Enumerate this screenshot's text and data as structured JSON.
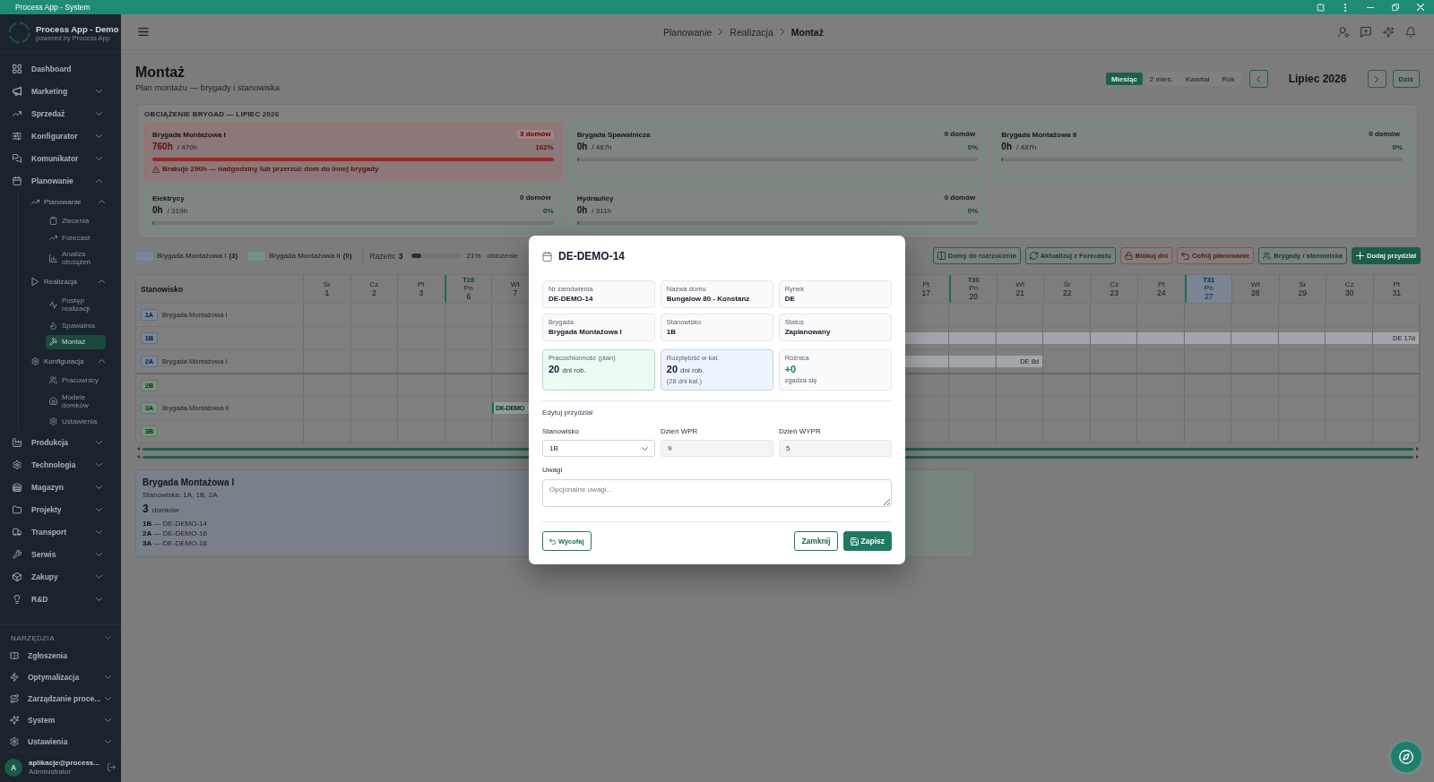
{
  "window": {
    "title": "Process App - System"
  },
  "sidebar": {
    "brand": {
      "name": "Process App - Demo",
      "tagline": "powered by Process App"
    },
    "items": [
      {
        "label": "Dashboard",
        "selected": false
      },
      {
        "label": "Marketing",
        "selected": false,
        "expanded": false
      },
      {
        "label": "Sprzedaż",
        "selected": false,
        "expanded": false
      },
      {
        "label": "Konfigurator",
        "selected": false,
        "expanded": false
      },
      {
        "label": "Komunikator",
        "selected": false,
        "expanded": false
      },
      {
        "label": "Planowanie",
        "selected": false,
        "expanded": true,
        "children": [
          {
            "label": "Planowanie",
            "selected": false,
            "expanded": true,
            "children": [
              {
                "label": "Zlecenia",
                "selected": false
              },
              {
                "label": "Forecast",
                "selected": false
              },
              {
                "label": "Analiza obciążeń",
                "selected": false
              }
            ]
          },
          {
            "label": "Realizacja",
            "selected": false,
            "expanded": true,
            "children": [
              {
                "label": "Postęp realizacji",
                "selected": false
              },
              {
                "label": "Spawalnia",
                "selected": false
              },
              {
                "label": "Montaż",
                "selected": true
              }
            ]
          },
          {
            "label": "Konfiguracja",
            "selected": false,
            "expanded": true,
            "children": [
              {
                "label": "Pracownicy",
                "selected": false
              },
              {
                "label": "Modele domków",
                "selected": false
              },
              {
                "label": "Ustawienia",
                "selected": false
              }
            ]
          }
        ]
      },
      {
        "label": "Produkcja",
        "selected": false,
        "expanded": false
      },
      {
        "label": "Technologia",
        "selected": false,
        "expanded": false
      },
      {
        "label": "Magazyn",
        "selected": false,
        "expanded": false
      },
      {
        "label": "Projekty",
        "selected": false,
        "expanded": false
      },
      {
        "label": "Transport",
        "selected": false,
        "expanded": false
      },
      {
        "label": "Serwis",
        "selected": false,
        "expanded": false
      },
      {
        "label": "Zakupy",
        "selected": false,
        "expanded": false
      },
      {
        "label": "R&D",
        "selected": false,
        "expanded": false
      }
    ],
    "tools": {
      "title": "NARZĘDZIA",
      "items": [
        {
          "label": "Zgłoszenia",
          "selected": false
        },
        {
          "label": "Optymalizacja",
          "selected": false,
          "expanded": false
        },
        {
          "label": "Zarządzanie proce...",
          "selected": false,
          "expanded": false
        },
        {
          "label": "System",
          "selected": false,
          "expanded": false
        },
        {
          "label": "Ustawienia",
          "selected": false,
          "expanded": false
        }
      ]
    },
    "user": {
      "initial": "A",
      "name": "aplikacje@process...",
      "role": "Administrator"
    }
  },
  "header": {
    "breadcrumb": [
      {
        "label": "Planowanie",
        "current": false
      },
      {
        "label": "Realizacja",
        "current": false
      },
      {
        "label": "Montaż",
        "current": true
      }
    ]
  },
  "page": {
    "title": "Montaż",
    "subtitle": "Plan montażu — brygady i stanowiska",
    "views": [
      {
        "label": "Miesiąc",
        "selected": true
      },
      {
        "label": "2 mies.",
        "selected": false
      },
      {
        "label": "Kwartał",
        "selected": false
      },
      {
        "label": "Rok",
        "selected": false
      }
    ],
    "period": "Lipiec 2026",
    "today_button": "Dziś"
  },
  "workload": {
    "title": "OBCIĄŻENIE BRYGAD — LIPIEC 2026",
    "brigades": [
      {
        "name": "Brygada Montażowa I",
        "houses": "3 domów",
        "hours": "760h",
        "capacity": "/ 470h",
        "percent": "162%",
        "level": 1,
        "overloaded": true,
        "warning": "Brakuje 290h — nadgodziny lub przerzuć dom do innej brygady"
      },
      {
        "name": "Brygada Spawalnicza",
        "houses": "0 domów",
        "hours": "0h",
        "capacity": "/ 487h",
        "percent": "0%",
        "level": 0,
        "overloaded": false
      },
      {
        "name": "Brygada Montażowa II",
        "houses": "0 domów",
        "hours": "0h",
        "capacity": "/ 487h",
        "percent": "0%",
        "level": 0,
        "overloaded": false
      },
      {
        "name": "Elektrycy",
        "houses": "0 domów",
        "hours": "0h",
        "capacity": "/ 319h",
        "percent": "0%",
        "level": 0,
        "overloaded": false
      },
      {
        "name": "Hydraulicy",
        "houses": "0 domów",
        "hours": "0h",
        "capacity": "/ 311h",
        "percent": "0%",
        "level": 0,
        "overloaded": false
      }
    ]
  },
  "legend": {
    "items": [
      {
        "label": "Brygada Montażowa I",
        "count": "(3)",
        "color": "#7a8799"
      },
      {
        "label": "Brygada Montażowa II",
        "count": "(0)",
        "color": "#76917f"
      }
    ],
    "total_label": "Razem:",
    "total": "3",
    "level": 0.21,
    "percent": "21%",
    "percent_label": "obłożenie"
  },
  "toolbar": {
    "buttons": [
      {
        "label": "Domy do rozrzucenia",
        "kind": "outline"
      },
      {
        "label": "Aktualizuj z Forecastu",
        "kind": "outline"
      },
      {
        "label": "Blokuj dni",
        "kind": "danger"
      },
      {
        "label": "Cofnij planowanie",
        "kind": "danger"
      },
      {
        "label": "Brygady / stanowiska",
        "kind": "outline"
      },
      {
        "label": "Dodaj przydział",
        "kind": "primary"
      }
    ]
  },
  "schedule": {
    "station_header": "Stanowisko",
    "days_left": [
      {
        "weekday": "Śr",
        "day": "1",
        "today": false
      },
      {
        "weekday": "Cz",
        "day": "2",
        "today": false
      },
      {
        "weekday": "Pt",
        "day": "3",
        "today": false
      },
      {
        "week": "T28",
        "weekday": "Pn",
        "day": "6",
        "today": false
      },
      {
        "weekday": "Wt",
        "day": "7",
        "today": false
      }
    ],
    "days_right": [
      {
        "weekday": "Pt",
        "day": "17",
        "today": false
      },
      {
        "week": "T30",
        "weekday": "Pn",
        "day": "20",
        "today": false
      },
      {
        "weekday": "Wt",
        "day": "21",
        "today": false
      },
      {
        "weekday": "Śr",
        "day": "22",
        "today": false
      },
      {
        "weekday": "Cz",
        "day": "23",
        "today": false
      },
      {
        "weekday": "Pt",
        "day": "24",
        "today": false
      },
      {
        "week": "T31",
        "weekday": "Pn",
        "day": "27",
        "today": true
      },
      {
        "weekday": "Wt",
        "day": "28",
        "today": false
      },
      {
        "weekday": "Śr",
        "day": "29",
        "today": false
      },
      {
        "weekday": "Cz",
        "day": "30",
        "today": false
      },
      {
        "weekday": "Pt",
        "day": "31",
        "today": false
      }
    ],
    "rows": [
      {
        "station": "1A",
        "brigade": "Brygada Montażowa I",
        "color": "#7a8799"
      },
      {
        "station": "1B",
        "color": "#7a8799",
        "bar": {
          "label": "DE 17d",
          "booked_left": [
            false,
            false,
            false,
            false,
            false
          ],
          "booked_right": [
            true,
            true,
            true,
            true,
            true,
            true,
            true,
            true,
            true,
            true,
            true
          ]
        }
      },
      {
        "station": "2A",
        "brigade": "Brygada Montażowa I",
        "color": "#7a8799",
        "bar": {
          "label": "DE 8d",
          "booked_left": [
            false,
            false,
            false,
            false,
            false
          ],
          "booked_right": [
            true,
            true,
            true,
            false,
            false,
            false,
            false,
            false,
            false,
            false,
            false
          ]
        }
      },
      {
        "station": "2B",
        "color": "#76917f"
      },
      {
        "station": "3A",
        "brigade": "Brygada Montażowa II",
        "color": "#76917f",
        "bar": {
          "label": "DE-DEMO",
          "booked_left": [
            false,
            false,
            false,
            false,
            true
          ],
          "booked_right": [
            false,
            false,
            false,
            false,
            false,
            false,
            false,
            false,
            false,
            false,
            false
          ]
        }
      },
      {
        "station": "3B",
        "color": "#76917f"
      }
    ]
  },
  "summary": [
    {
      "title": "Brygada Montażowa I",
      "stations": "Stanowiska: 1A, 1B, 2A",
      "count": "3",
      "count_label": "domków",
      "assignments": [
        "**1B** — DE-DEMO-14",
        "**2A** — DE-DEMO-16",
        "**3A** — DE-DEMO-18"
      ],
      "color": "#7a8089"
    },
    {
      "color": "#79867e"
    }
  ],
  "assignment_dialog": {
    "title": "DE-DEMO-14",
    "info": [
      {
        "label": "Nr zamówienia",
        "value": "DE-DEMO-14"
      },
      {
        "label": "Nazwa domu",
        "value": "Bungalow 80 - Konstanz"
      },
      {
        "label": "Rynek",
        "value": "DE"
      },
      {
        "label": "Brygada",
        "value": "Brygada Montażowa I"
      },
      {
        "label": "Stanowisko",
        "value": "1B"
      },
      {
        "label": "Status",
        "value": "Zaplanowany"
      }
    ],
    "stats": [
      {
        "kind": "plan",
        "label": "Pracochłonność (plan)",
        "value": "20",
        "unit": "dni rob."
      },
      {
        "kind": "span",
        "label": "Rozpiętość w kal.",
        "value": "20",
        "unit": "dni rob.",
        "note": "(28 dni kal.)"
      },
      {
        "kind": "diff",
        "label": "Różnica",
        "value": "+0",
        "note": "zgadza się"
      }
    ],
    "section_title": "Edytuj przydział",
    "fields": [
      {
        "kind": "select",
        "label": "Stanowisko",
        "value": "1B",
        "disabled": false
      },
      {
        "kind": "input",
        "label": "Dzień WPR",
        "value": "9",
        "disabled": true
      },
      {
        "kind": "input",
        "label": "Dzień WYPR",
        "value": "5",
        "disabled": true
      }
    ],
    "notes": {
      "label": "Uwagi",
      "placeholder": "Opcjonalne uwagi..."
    },
    "buttons": [
      {
        "label": "Wycofaj",
        "kind": "revert"
      },
      {
        "label": "Zamknij",
        "kind": "close"
      },
      {
        "label": "Zapisz",
        "kind": "save"
      }
    ]
  }
}
